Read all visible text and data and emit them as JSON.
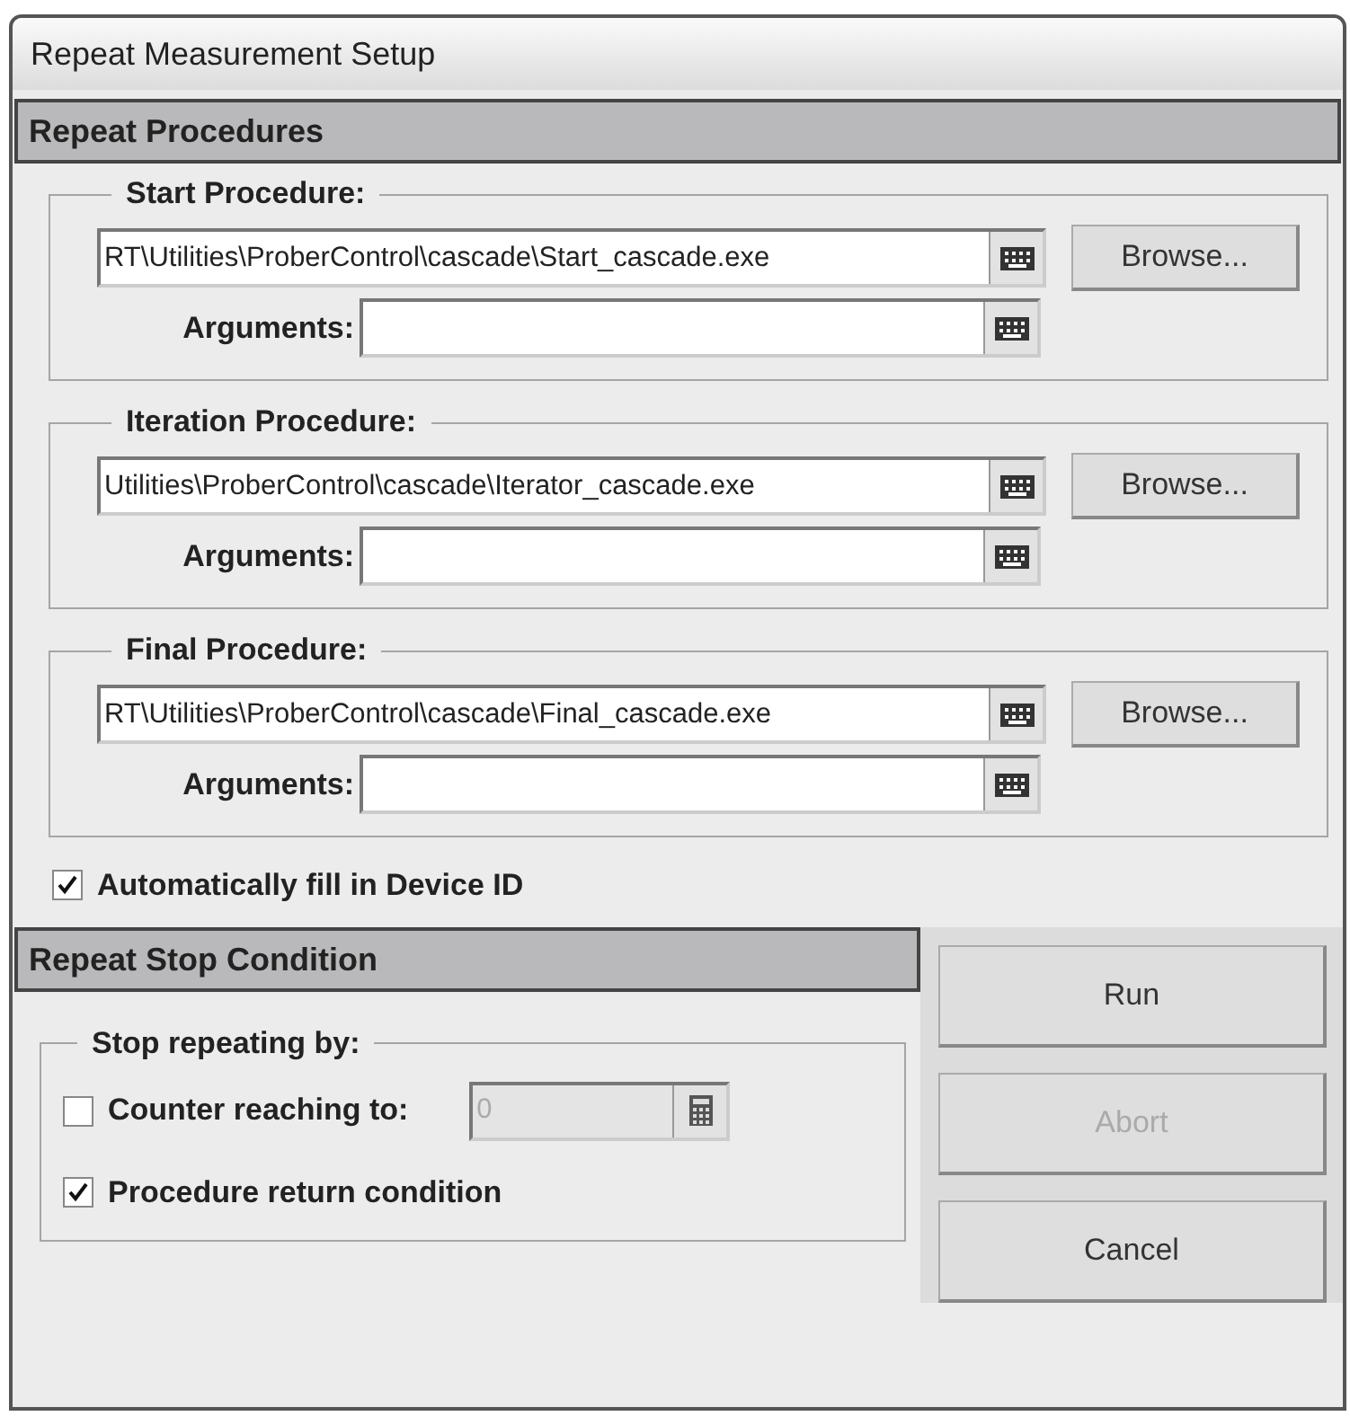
{
  "window": {
    "title": "Repeat Measurement Setup"
  },
  "repeat_procedures": {
    "header": "Repeat Procedures",
    "groups": [
      {
        "legend": "Start Procedure:",
        "path": "RT\\Utilities\\ProberControl\\cascade\\Start_cascade.exe",
        "browse": "Browse...",
        "arguments_label": "Arguments:"
      },
      {
        "legend": "Iteration Procedure:",
        "path": "Utilities\\ProberControl\\cascade\\Iterator_cascade.exe",
        "browse": "Browse...",
        "arguments_label": "Arguments:"
      },
      {
        "legend": "Final Procedure:",
        "path": "RT\\Utilities\\ProberControl\\cascade\\Final_cascade.exe",
        "browse": "Browse...",
        "arguments_label": "Arguments:"
      }
    ]
  },
  "auto_fill": {
    "label": "Automatically fill in Device ID",
    "checked": true
  },
  "stop_condition": {
    "header": "Repeat Stop Condition",
    "legend": "Stop repeating by:",
    "options": [
      {
        "kind": "counter",
        "label": "Counter reaching to:",
        "checked": false,
        "value": "0",
        "disabled": true
      },
      {
        "kind": "plain",
        "label": "Procedure return condition",
        "checked": true
      }
    ]
  },
  "buttons": [
    {
      "label": "Run",
      "disabled": false
    },
    {
      "label": "Abort",
      "disabled": true
    },
    {
      "label": "Cancel",
      "disabled": false
    }
  ]
}
